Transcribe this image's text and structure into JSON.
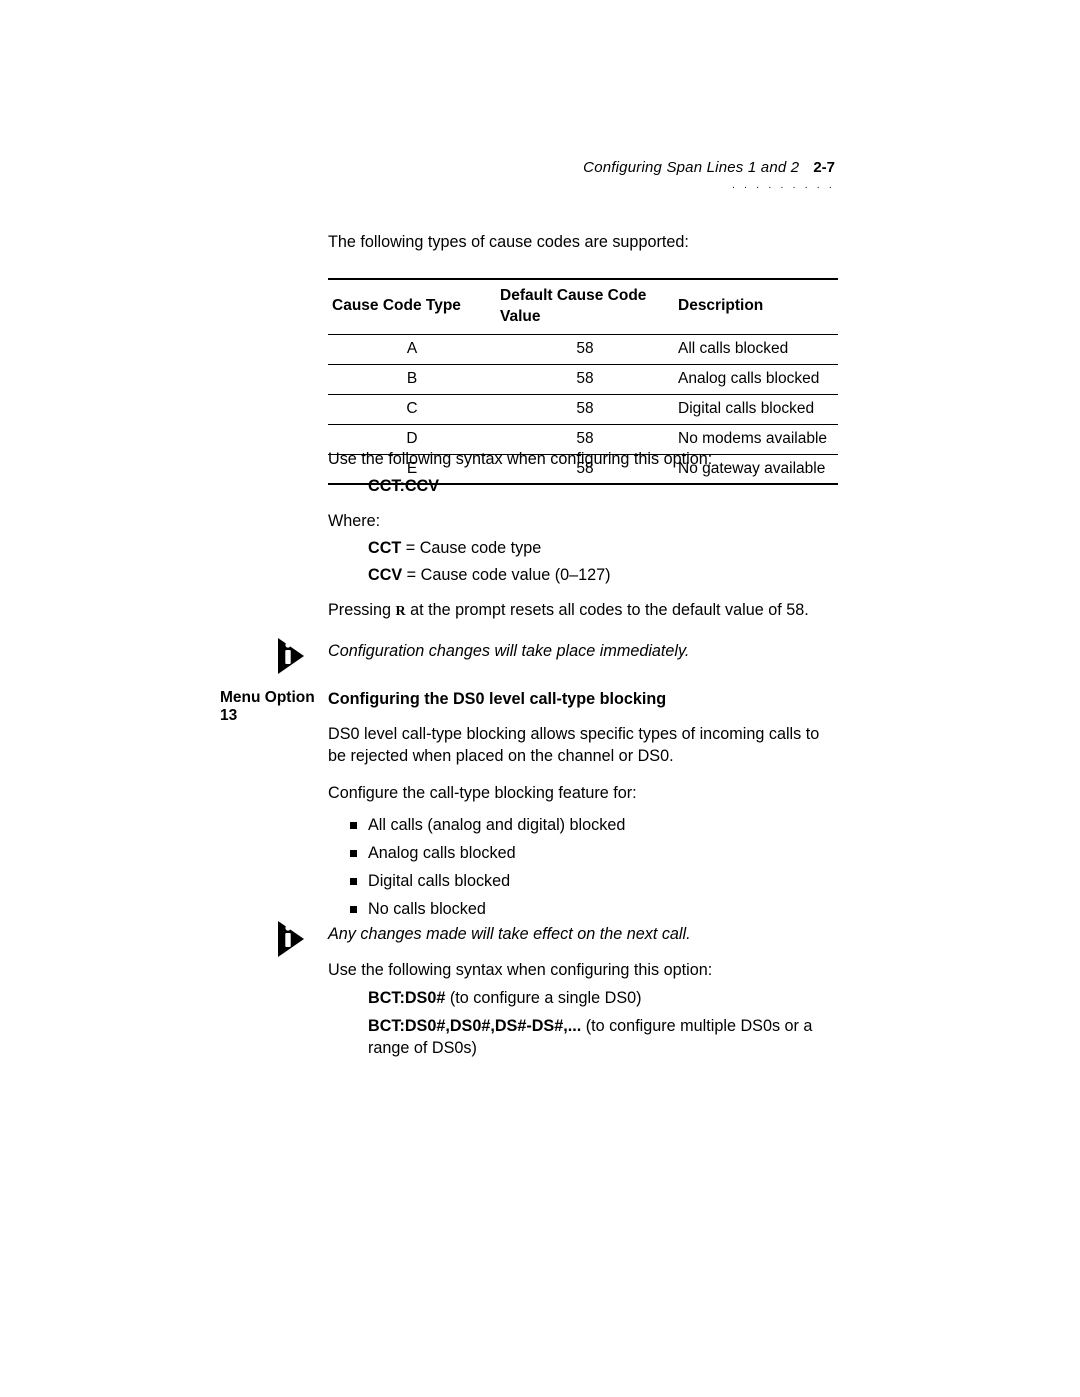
{
  "header": {
    "title": "Configuring Span Lines 1 and 2",
    "page": "2-7",
    "dots": "· · · · · · · · ·"
  },
  "intro_para": "The following types of cause codes are supported:",
  "cause_table": {
    "headers": [
      "Cause Code Type",
      "Default Cause Code Value",
      "Description"
    ],
    "rows": [
      {
        "type": "A",
        "value": "58",
        "desc": "All calls blocked"
      },
      {
        "type": "B",
        "value": "58",
        "desc": "Analog calls blocked"
      },
      {
        "type": "C",
        "value": "58",
        "desc": "Digital calls blocked"
      },
      {
        "type": "D",
        "value": "58",
        "desc": "No modems available"
      },
      {
        "type": "E",
        "value": "58",
        "desc": "No gateway available"
      }
    ]
  },
  "syntax_lead": "Use the following syntax when configuring this option:",
  "syntax_code": "CCT:CCV",
  "where_label": "Where:",
  "where_items": [
    {
      "bold": "CCT",
      "rest": " = Cause code type"
    },
    {
      "bold": "CCV",
      "rest": " = Cause code value (0–127)"
    }
  ],
  "reset_line": {
    "pre": "Pressing ",
    "key": "R",
    "post": " at the prompt resets all codes to the default value of 58."
  },
  "note1": "Configuration changes will take place immediately.",
  "menu_option_label": "Menu Option 13",
  "section13_title": "Configuring the DS0 level call-type blocking",
  "section13_para": "DS0 level call-type blocking allows specific types of incoming calls to be rejected when placed on the channel or DS0.",
  "section13_lead": "Configure the call-type blocking feature for:",
  "section13_list": [
    "All calls (analog and digital) blocked",
    "Analog calls blocked",
    "Digital calls blocked",
    "No calls blocked"
  ],
  "note2": "Any changes made will take effect on the next call.",
  "syntax2_lead": "Use the following syntax when configuring this option:",
  "syntax2_items": [
    {
      "bold": "BCT:DS0#",
      "rest": " (to configure a single DS0)"
    },
    {
      "bold": "BCT:DS0#,DS0#,DS#-DS#,...",
      "rest": " (to configure multiple DS0s or a range of DS0s)"
    }
  ]
}
